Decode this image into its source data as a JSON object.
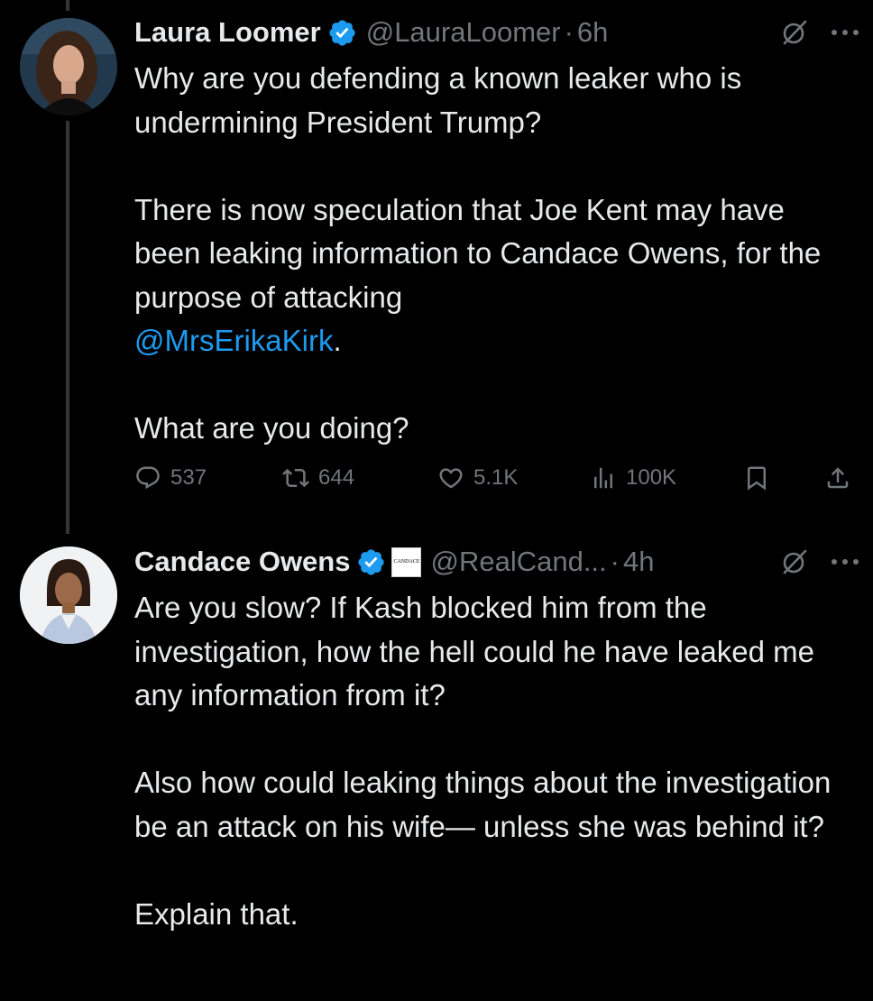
{
  "tweets": [
    {
      "author": "Laura Loomer",
      "handle": "@LauraLoomer",
      "separator": "·",
      "time": "6h",
      "paragraphs": [
        "Why are you defending a known leaker who is undermining President Trump?",
        "There is now speculation that Joe Kent may have been leaking information to Candace Owens, for the purpose of attacking",
        "What are you doing?"
      ],
      "mention": "@MrsErikaKirk",
      "mention_suffix": ".",
      "stats": {
        "replies": "537",
        "reposts": "644",
        "likes": "5.1K",
        "views": "100K"
      },
      "icons": {
        "avatar": "avatar-photo",
        "verified": "verified-badge-icon",
        "grok": "grok-icon",
        "more": "more-icon"
      }
    },
    {
      "author": "Candace Owens",
      "handle": "@RealCand...",
      "separator": "·",
      "time": "4h",
      "affiliate_label": "CANDACE",
      "paragraphs": [
        "Are you slow? If Kash blocked him from the investigation, how the hell could he have leaked me any information from it?",
        "Also how could leaking things about the investigation be an attack on his wife— unless she was behind it?",
        "Explain that."
      ],
      "icons": {
        "avatar": "avatar-photo",
        "verified": "verified-badge-icon",
        "grok": "grok-icon",
        "more": "more-icon"
      }
    }
  ],
  "colors": {
    "background": "#000000",
    "text": "#e7e9ea",
    "muted": "#71767b",
    "link": "#1d9bf0",
    "verified": "#1d9bf0",
    "thread_line": "#333639"
  }
}
